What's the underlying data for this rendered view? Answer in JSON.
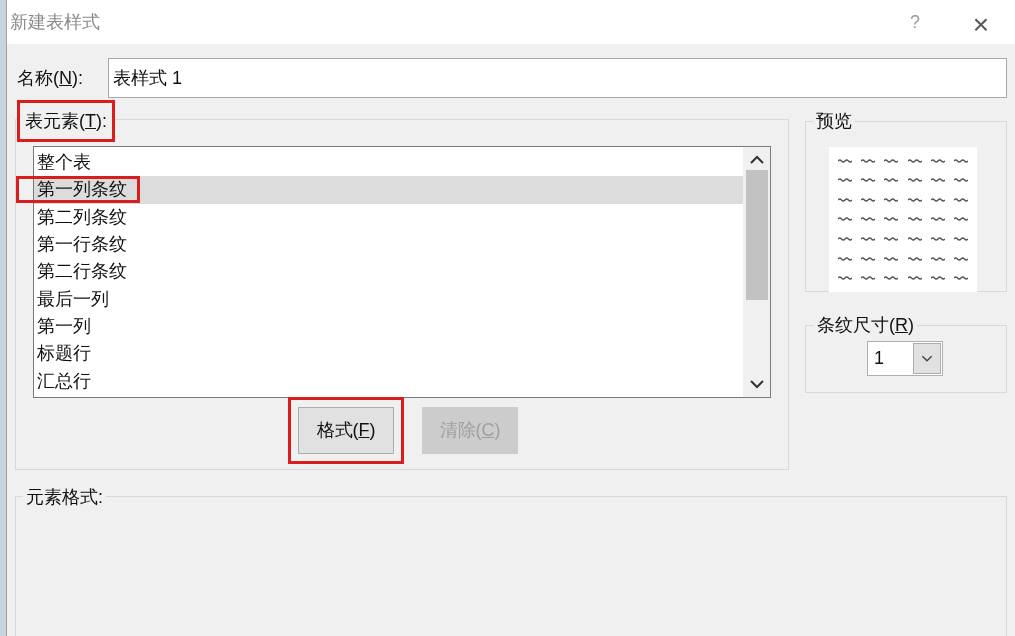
{
  "window": {
    "title": "新建表样式",
    "help": "?",
    "close": "×"
  },
  "name_field": {
    "label": {
      "before": "名称(",
      "key": "N",
      "after": "):"
    },
    "value": "表样式 1"
  },
  "table_elements": {
    "label": {
      "before": "表元素(",
      "key": "T",
      "after": "):"
    },
    "highlighted": true,
    "items": [
      {
        "text": "整个表",
        "selected": false,
        "highlighted": false
      },
      {
        "text": "第一列条纹",
        "selected": true,
        "highlighted": true
      },
      {
        "text": "第二列条纹",
        "selected": false,
        "highlighted": false
      },
      {
        "text": "第一行条纹",
        "selected": false,
        "highlighted": false
      },
      {
        "text": "第二行条纹",
        "selected": false,
        "highlighted": false
      },
      {
        "text": "最后一列",
        "selected": false,
        "highlighted": false
      },
      {
        "text": "第一列",
        "selected": false,
        "highlighted": false
      },
      {
        "text": "标题行",
        "selected": false,
        "highlighted": false
      },
      {
        "text": "汇总行",
        "selected": false,
        "highlighted": false
      }
    ],
    "buttons": [
      {
        "label": {
          "before": "格式(",
          "key": "F",
          "after": ")"
        },
        "disabled": false,
        "highlighted": true
      },
      {
        "label": {
          "before": "清除(",
          "key": "C",
          "after": ")"
        },
        "disabled": true,
        "highlighted": false
      }
    ]
  },
  "preview": {
    "title": "预览"
  },
  "stripe_size": {
    "title": {
      "before": "条纹尺寸(",
      "key": "R",
      "after": ")"
    },
    "value": "1"
  },
  "element_format": {
    "title": "元素格式:"
  }
}
